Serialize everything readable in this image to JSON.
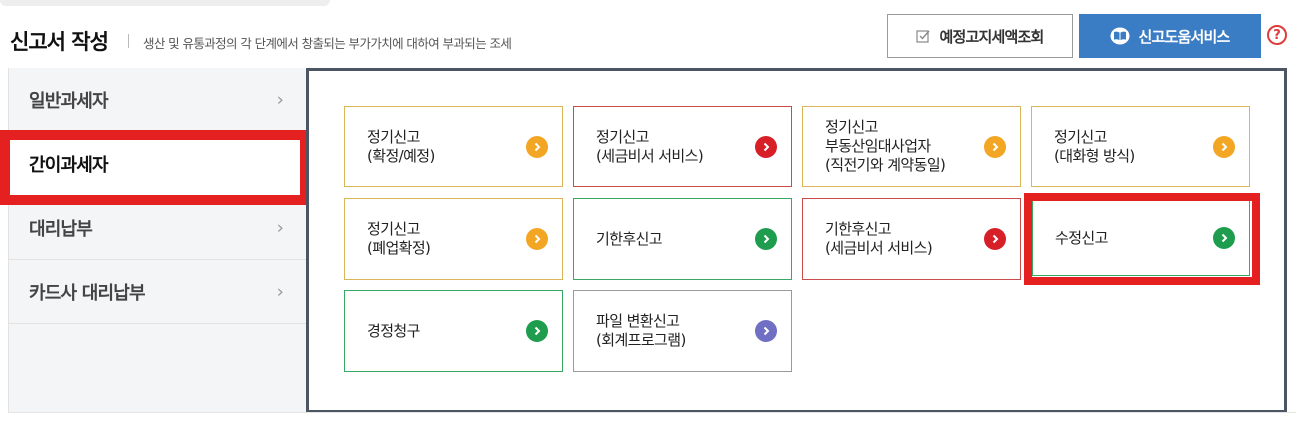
{
  "header": {
    "title": "신고서 작성",
    "description": "생산 및 유통과정의 각 단계에서 창출되는 부가가치에 대하여 부과되는 조세",
    "notice_button": "예정고지세액조회",
    "help_button": "신고도움서비스",
    "help_icon_text": "?"
  },
  "sidebar": {
    "items": [
      {
        "label": "일반과세자",
        "active": false
      },
      {
        "label": "간이과세자",
        "active": true
      },
      {
        "label": "대리납부",
        "active": false
      },
      {
        "label": "카드사 대리납부",
        "active": false
      }
    ],
    "chevron": "›"
  },
  "cards": [
    {
      "line1": "정기신고",
      "line2": "(확정/예정)",
      "line3": "",
      "border": "#d9b65a",
      "arrow": "#f2a623"
    },
    {
      "line1": "정기신고",
      "line2": "(세금비서 서비스)",
      "line3": "",
      "border": "#c94b4b",
      "arrow": "#d61f26"
    },
    {
      "line1": "정기신고",
      "line2": "부동산임대사업자",
      "line3": "(직전기와 계약동일)",
      "border": "#d9b65a",
      "arrow": "#f2a623"
    },
    {
      "line1": "정기신고",
      "line2": "(대화형 방식)",
      "line3": "",
      "border": "#d9b65a",
      "arrow": "#f2a623"
    },
    {
      "line1": "정기신고",
      "line2": "(폐업확정)",
      "line3": "",
      "border": "#d9b65a",
      "arrow": "#f2a623"
    },
    {
      "line1": "기한후신고",
      "line2": "",
      "line3": "",
      "border": "#3aa865",
      "arrow": "#1f9d4e"
    },
    {
      "line1": "기한후신고",
      "line2": "(세금비서 서비스)",
      "line3": "",
      "border": "#c94b4b",
      "arrow": "#d61f26"
    },
    {
      "line1": "수정신고",
      "line2": "",
      "line3": "",
      "border": "#3aa865",
      "arrow": "#1f9d4e"
    },
    {
      "line1": "경정청구",
      "line2": "",
      "line3": "",
      "border": "#3aa865",
      "arrow": "#1f9d4e"
    },
    {
      "line1": "파일 변환신고",
      "line2": "(회계프로그램)",
      "line3": "",
      "border": "#3aa865",
      "arrow": "#6f6fc4"
    }
  ],
  "colors": {
    "primary_button": "#3b7dc4",
    "highlight": "#e52020",
    "panel_border": "#4b5563"
  }
}
